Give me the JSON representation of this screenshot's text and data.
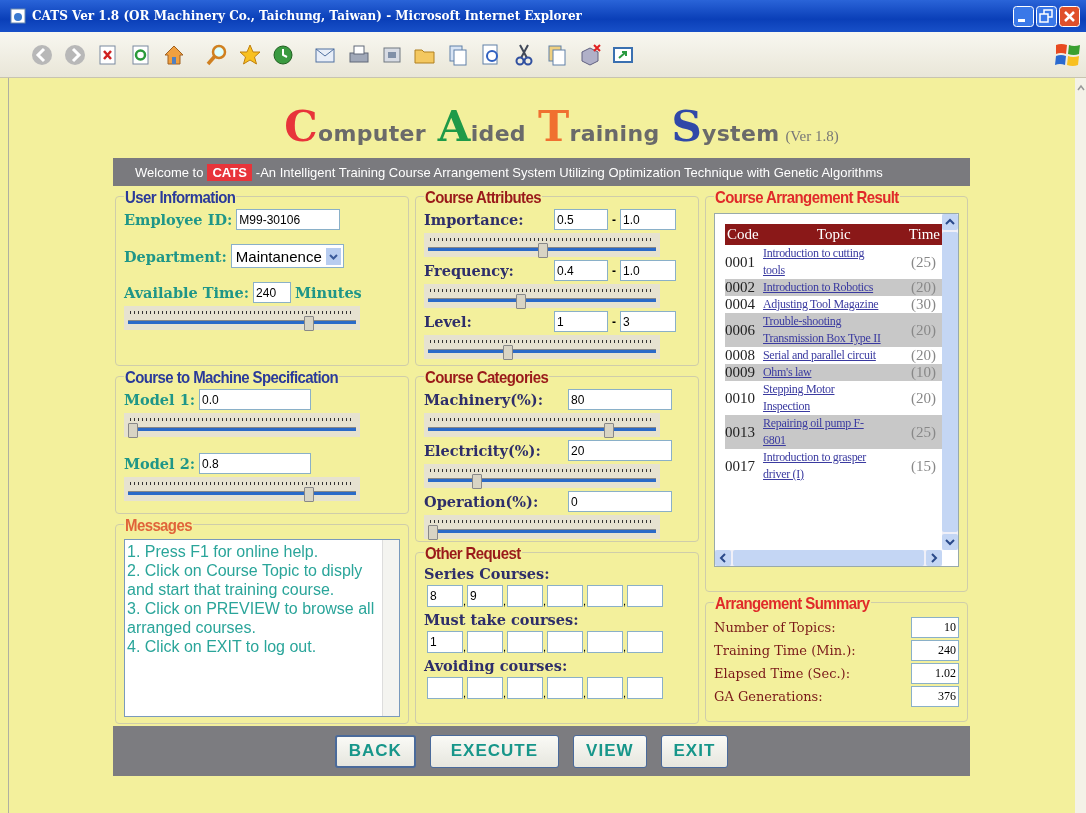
{
  "window": {
    "title": "CATS Ver 1.8 (OR Machinery Co., Taichung, Taiwan) - Microsoft Internet Explorer"
  },
  "header": {
    "title_words": [
      {
        "initial": "C",
        "rest": "omputer",
        "color": "#e8343a"
      },
      {
        "initial": "A",
        "rest": "ided",
        "color": "#1e9a48"
      },
      {
        "initial": "T",
        "rest": "raining",
        "color": "#f07030"
      },
      {
        "initial": "S",
        "rest": "ystem",
        "color": "#3048a8"
      }
    ],
    "version": "(Ver 1.8)",
    "welcome_prefix": "Welcome to",
    "badge": "CATS",
    "welcome_text": "-An Intelligent Training Course Arrangement System Utilizing Optimization Technique with Genetic Algorithms"
  },
  "user_information": {
    "legend": "User Information",
    "employee_id": {
      "label": "Employee ID:",
      "value": "M99-30106"
    },
    "department": {
      "label": "Department:",
      "value": "Maintanence"
    },
    "available_time": {
      "label": "Available Time:",
      "value": "240",
      "unit": "Minutes",
      "level": 0.8
    }
  },
  "machine_spec": {
    "legend": "Course to Machine Specification",
    "models": [
      {
        "label": "Model 1:",
        "value": "0.0",
        "level": 0
      },
      {
        "label": "Model 2:",
        "value": "0.8",
        "level": 0.8
      }
    ]
  },
  "messages": {
    "legend": "Messages",
    "lines": [
      "1. Press F1 for online help.",
      "2. Click on Course Topic to disply and start that training course.",
      "3. Click on PREVIEW to browse all arranged courses.",
      "4. Click on EXIT to log out."
    ]
  },
  "course_attributes": {
    "legend": "Course Attributes",
    "range_separator": "-",
    "items": [
      {
        "label": "Importance:",
        "from": "0.5",
        "to": "1.0",
        "level": 0.5
      },
      {
        "label": "Frequency:",
        "from": "0.4",
        "to": "1.0",
        "level": 0.4
      },
      {
        "label": "Level:",
        "from": "1",
        "to": "3",
        "level": 0.34
      }
    ]
  },
  "course_categories": {
    "legend": "Course Categories",
    "items": [
      {
        "label": "Machinery(%):",
        "value": "80",
        "level": 0.8
      },
      {
        "label": "Electricity(%):",
        "value": "20",
        "level": 0.2
      },
      {
        "label": "Operation(%):",
        "value": "0",
        "level": 0
      }
    ]
  },
  "other_request": {
    "legend": "Other Request",
    "separator": ",",
    "groups": [
      {
        "label": "Series Courses:",
        "fields": [
          {
            "kind": "filled",
            "value": "8"
          },
          {
            "kind": "filled",
            "value": "9"
          },
          {
            "kind": "empty"
          },
          {
            "kind": "empty"
          },
          {
            "kind": "empty"
          },
          {
            "kind": "empty"
          }
        ]
      },
      {
        "label": "Must take courses:",
        "fields": [
          {
            "kind": "filled",
            "value": "1"
          },
          {
            "kind": "empty"
          },
          {
            "kind": "empty"
          },
          {
            "kind": "empty"
          },
          {
            "kind": "empty"
          },
          {
            "kind": "empty"
          }
        ]
      },
      {
        "label": "Avoiding courses:",
        "fields": [
          {
            "kind": "empty"
          },
          {
            "kind": "empty"
          },
          {
            "kind": "empty"
          },
          {
            "kind": "empty"
          },
          {
            "kind": "empty"
          },
          {
            "kind": "empty"
          }
        ]
      }
    ]
  },
  "result": {
    "legend": "Course Arrangement Result",
    "columns": [
      "Code",
      "Topic",
      "Time"
    ],
    "rows": [
      {
        "code": "0001",
        "topic": "Introduction to cutting tools",
        "time": "(25)"
      },
      {
        "code": "0002",
        "topic": "Introduction to Robotics",
        "time": "(20)"
      },
      {
        "code": "0004",
        "topic": "Adjusting Tool Magazine",
        "time": "(30)"
      },
      {
        "code": "0006",
        "topic": "Trouble-shooting Transmission Box Type II",
        "time": "(20)"
      },
      {
        "code": "0008",
        "topic": "Serial and parallel circuit",
        "time": "(20)"
      },
      {
        "code": "0009",
        "topic": "Ohm's law",
        "time": "(10)"
      },
      {
        "code": "0010",
        "topic": "Stepping Motor Inspection",
        "time": "(20)"
      },
      {
        "code": "0013",
        "topic": "Repairing oil pump F-6801",
        "time": "(25)"
      },
      {
        "code": "0017",
        "topic": "Introduction to grasper driver (I)",
        "time": "(15)"
      }
    ]
  },
  "summary": {
    "legend": "Arrangement Summary",
    "items": [
      {
        "label": "Number of Topics:",
        "value": "10"
      },
      {
        "label": "Training Time (Min.):",
        "value": "240"
      },
      {
        "label": "Elapsed Time (Sec.):",
        "value": "1.02"
      },
      {
        "label": "GA Generations:",
        "value": "376"
      }
    ]
  },
  "buttons": [
    "BACK",
    "EXECUTE",
    "VIEW",
    "EXIT"
  ]
}
